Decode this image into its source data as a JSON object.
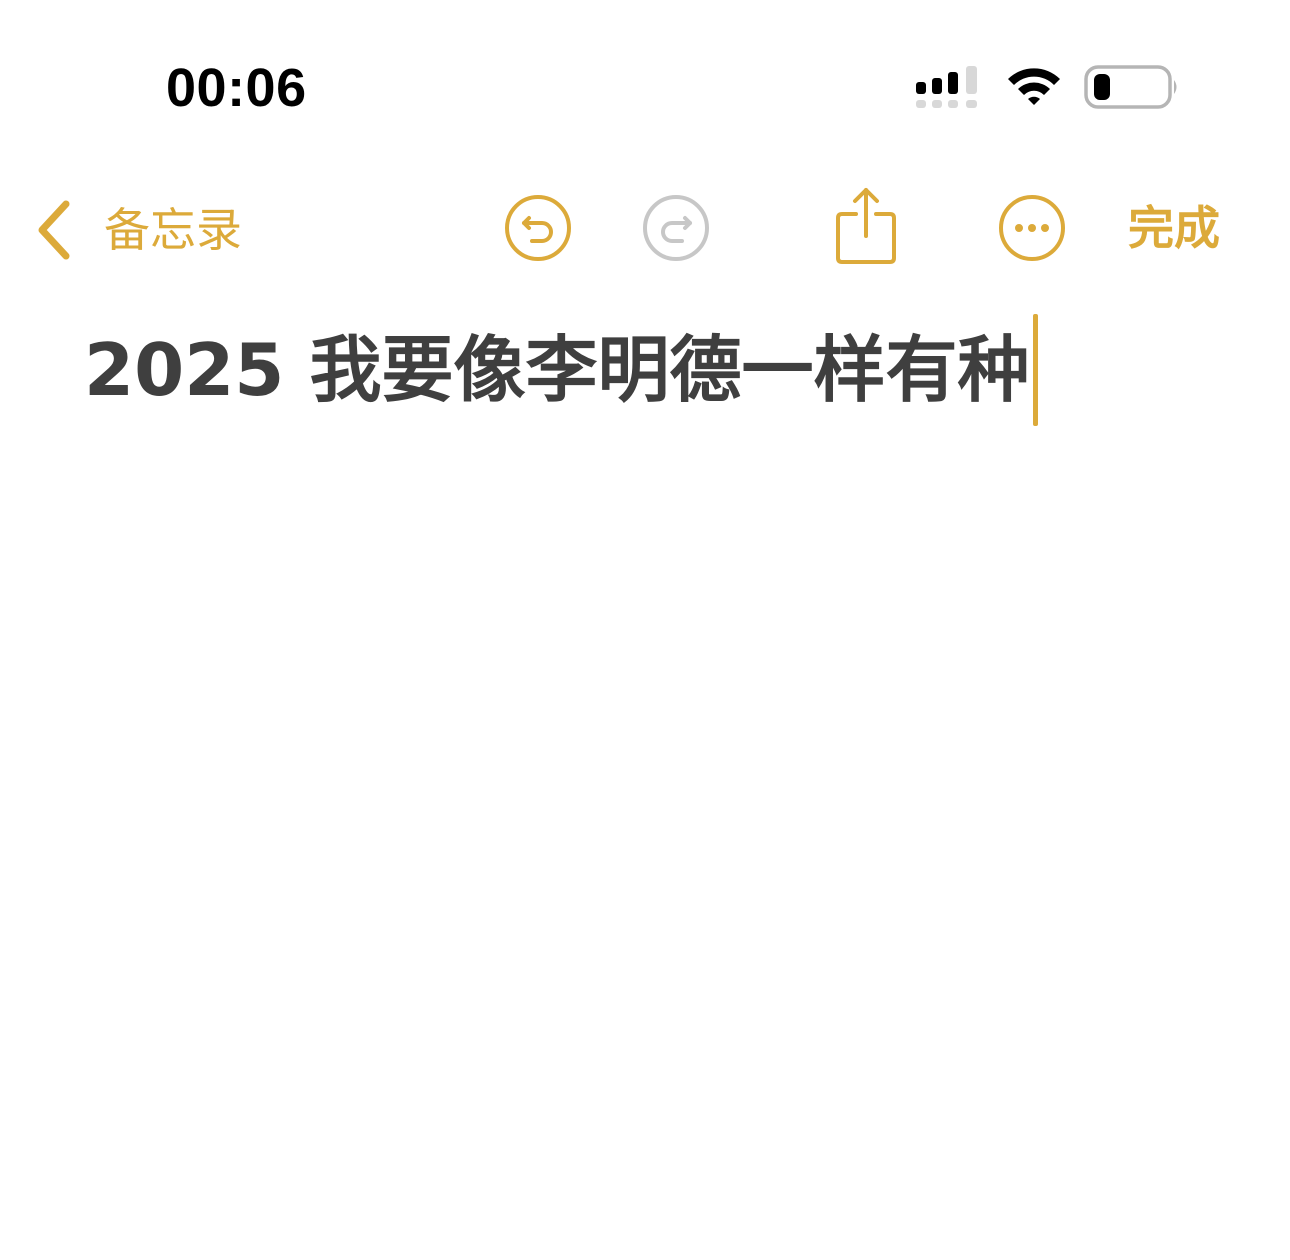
{
  "status_bar": {
    "time": "00:06",
    "cellular_icon": "cellular-signal-icon",
    "wifi_icon": "wifi-icon",
    "battery_icon": "battery-icon",
    "battery_level": 0.2
  },
  "nav": {
    "back_label": "备忘录",
    "back_icon": "chevron-left-icon",
    "undo_icon": "undo-icon",
    "redo_icon": "redo-icon",
    "share_icon": "share-icon",
    "more_icon": "ellipsis-circle-icon",
    "done_label": "完成"
  },
  "note": {
    "title": "2025 我要像李明德一样有种"
  },
  "colors": {
    "accent": "#dcaa3a",
    "text": "#3f3f3f",
    "disabled": "#c7c7c7",
    "background": "#ffffff"
  }
}
